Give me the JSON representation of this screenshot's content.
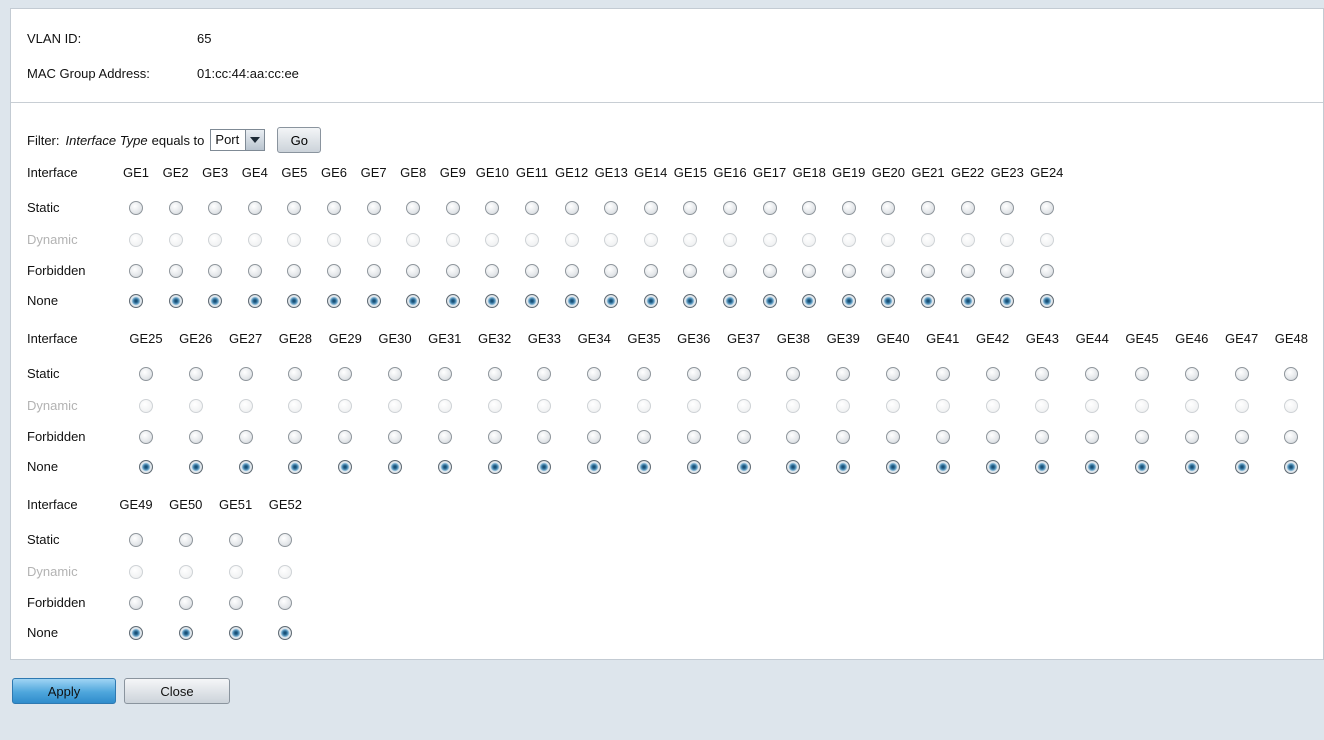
{
  "info": {
    "vlan_id_label": "VLAN ID:",
    "vlan_id_value": "65",
    "mac_group_label": "MAC Group Address:",
    "mac_group_value": "01:cc:44:aa:cc:ee"
  },
  "filter": {
    "label": "Filter:",
    "field": "Interface Type",
    "operator": "equals to",
    "selected": "Port",
    "go_label": "Go"
  },
  "row_labels": {
    "interface": "Interface",
    "static": "Static",
    "dynamic": "Dynamic",
    "forbidden": "Forbidden",
    "none": "None"
  },
  "groups": [
    {
      "interfaces": [
        "GE1",
        "GE2",
        "GE3",
        "GE4",
        "GE5",
        "GE6",
        "GE7",
        "GE8",
        "GE9",
        "GE10",
        "GE11",
        "GE12",
        "GE13",
        "GE14",
        "GE15",
        "GE16",
        "GE17",
        "GE18",
        "GE19",
        "GE20",
        "GE21",
        "GE22",
        "GE23",
        "GE24"
      ],
      "selected_option": "None"
    },
    {
      "interfaces": [
        "GE25",
        "GE26",
        "GE27",
        "GE28",
        "GE29",
        "GE30",
        "GE31",
        "GE32",
        "GE33",
        "GE34",
        "GE35",
        "GE36",
        "GE37",
        "GE38",
        "GE39",
        "GE40",
        "GE41",
        "GE42",
        "GE43",
        "GE44",
        "GE45",
        "GE46",
        "GE47",
        "GE48"
      ],
      "selected_option": "None"
    },
    {
      "interfaces": [
        "GE49",
        "GE50",
        "GE51",
        "GE52"
      ],
      "selected_option": "None"
    }
  ],
  "buttons": {
    "apply": "Apply",
    "close": "Close"
  },
  "colors": {
    "apply_button": "#4ea6dc",
    "selected_radio": "#2f6f99",
    "panel_background": "#ffffff",
    "page_background": "#dde5ec"
  }
}
